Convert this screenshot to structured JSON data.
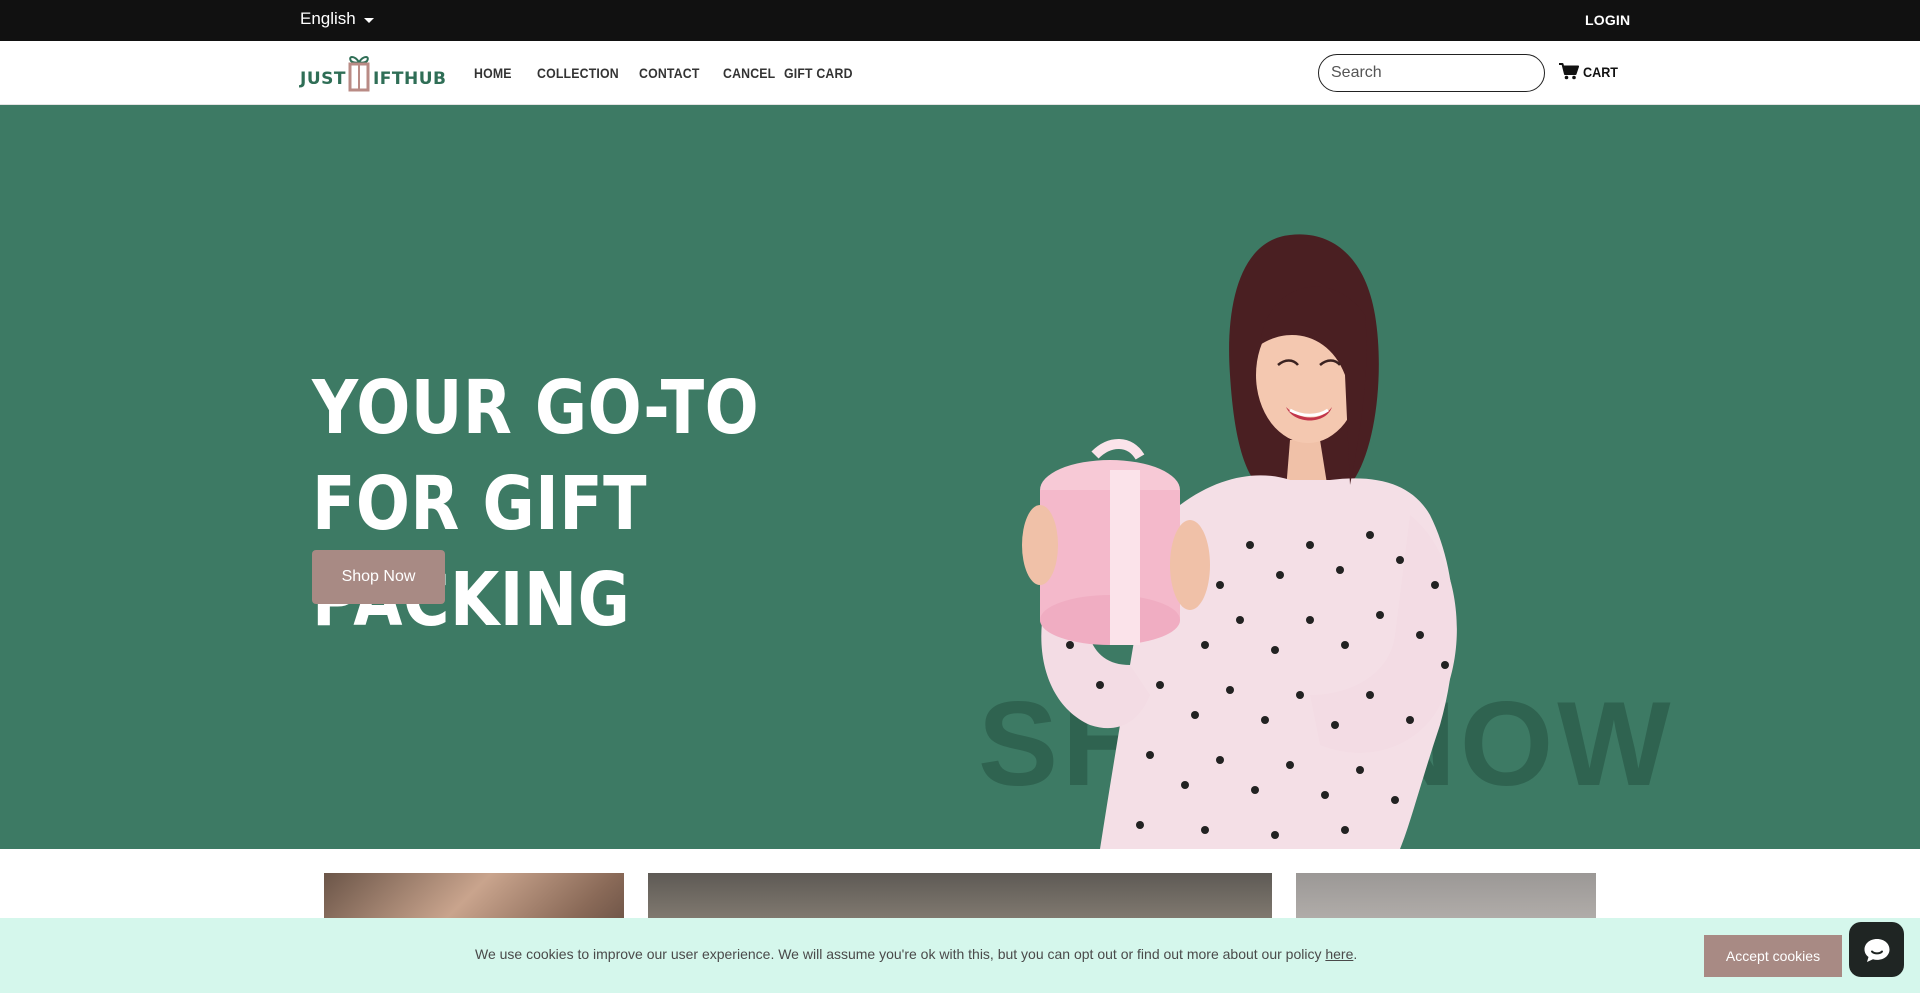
{
  "topbar": {
    "language": "English",
    "login": "LOGIN"
  },
  "brand": {
    "logo_text": "JUST GIFTHUB"
  },
  "nav": [
    {
      "label": "HOME"
    },
    {
      "label": "COLLECTION"
    },
    {
      "label": "CONTACT"
    },
    {
      "label": "CANCEL"
    },
    {
      "label": "GIFT CARD"
    }
  ],
  "search": {
    "placeholder": "Search",
    "value": ""
  },
  "cart": {
    "label": "CART",
    "icon": "cart-icon"
  },
  "hero": {
    "headline": "YOUR GO-TO FOR GIFT PACKING",
    "cta": "Shop Now",
    "ghost_text": "SHOP NOW"
  },
  "cookie": {
    "message": "We use cookies to improve our user experience. We will assume you're ok with this, but you can opt out or find out more about our policy ",
    "link": "here",
    "suffix": ".",
    "accept": "Accept cookies"
  },
  "chat": {
    "icon": "chat-bubble-icon"
  },
  "colors": {
    "topbar": "#111111",
    "hero_bg": "#3d7a64",
    "accent": "#a88a84",
    "cookie_bg": "#d5f7ec",
    "brand_green": "#2f6e56"
  }
}
